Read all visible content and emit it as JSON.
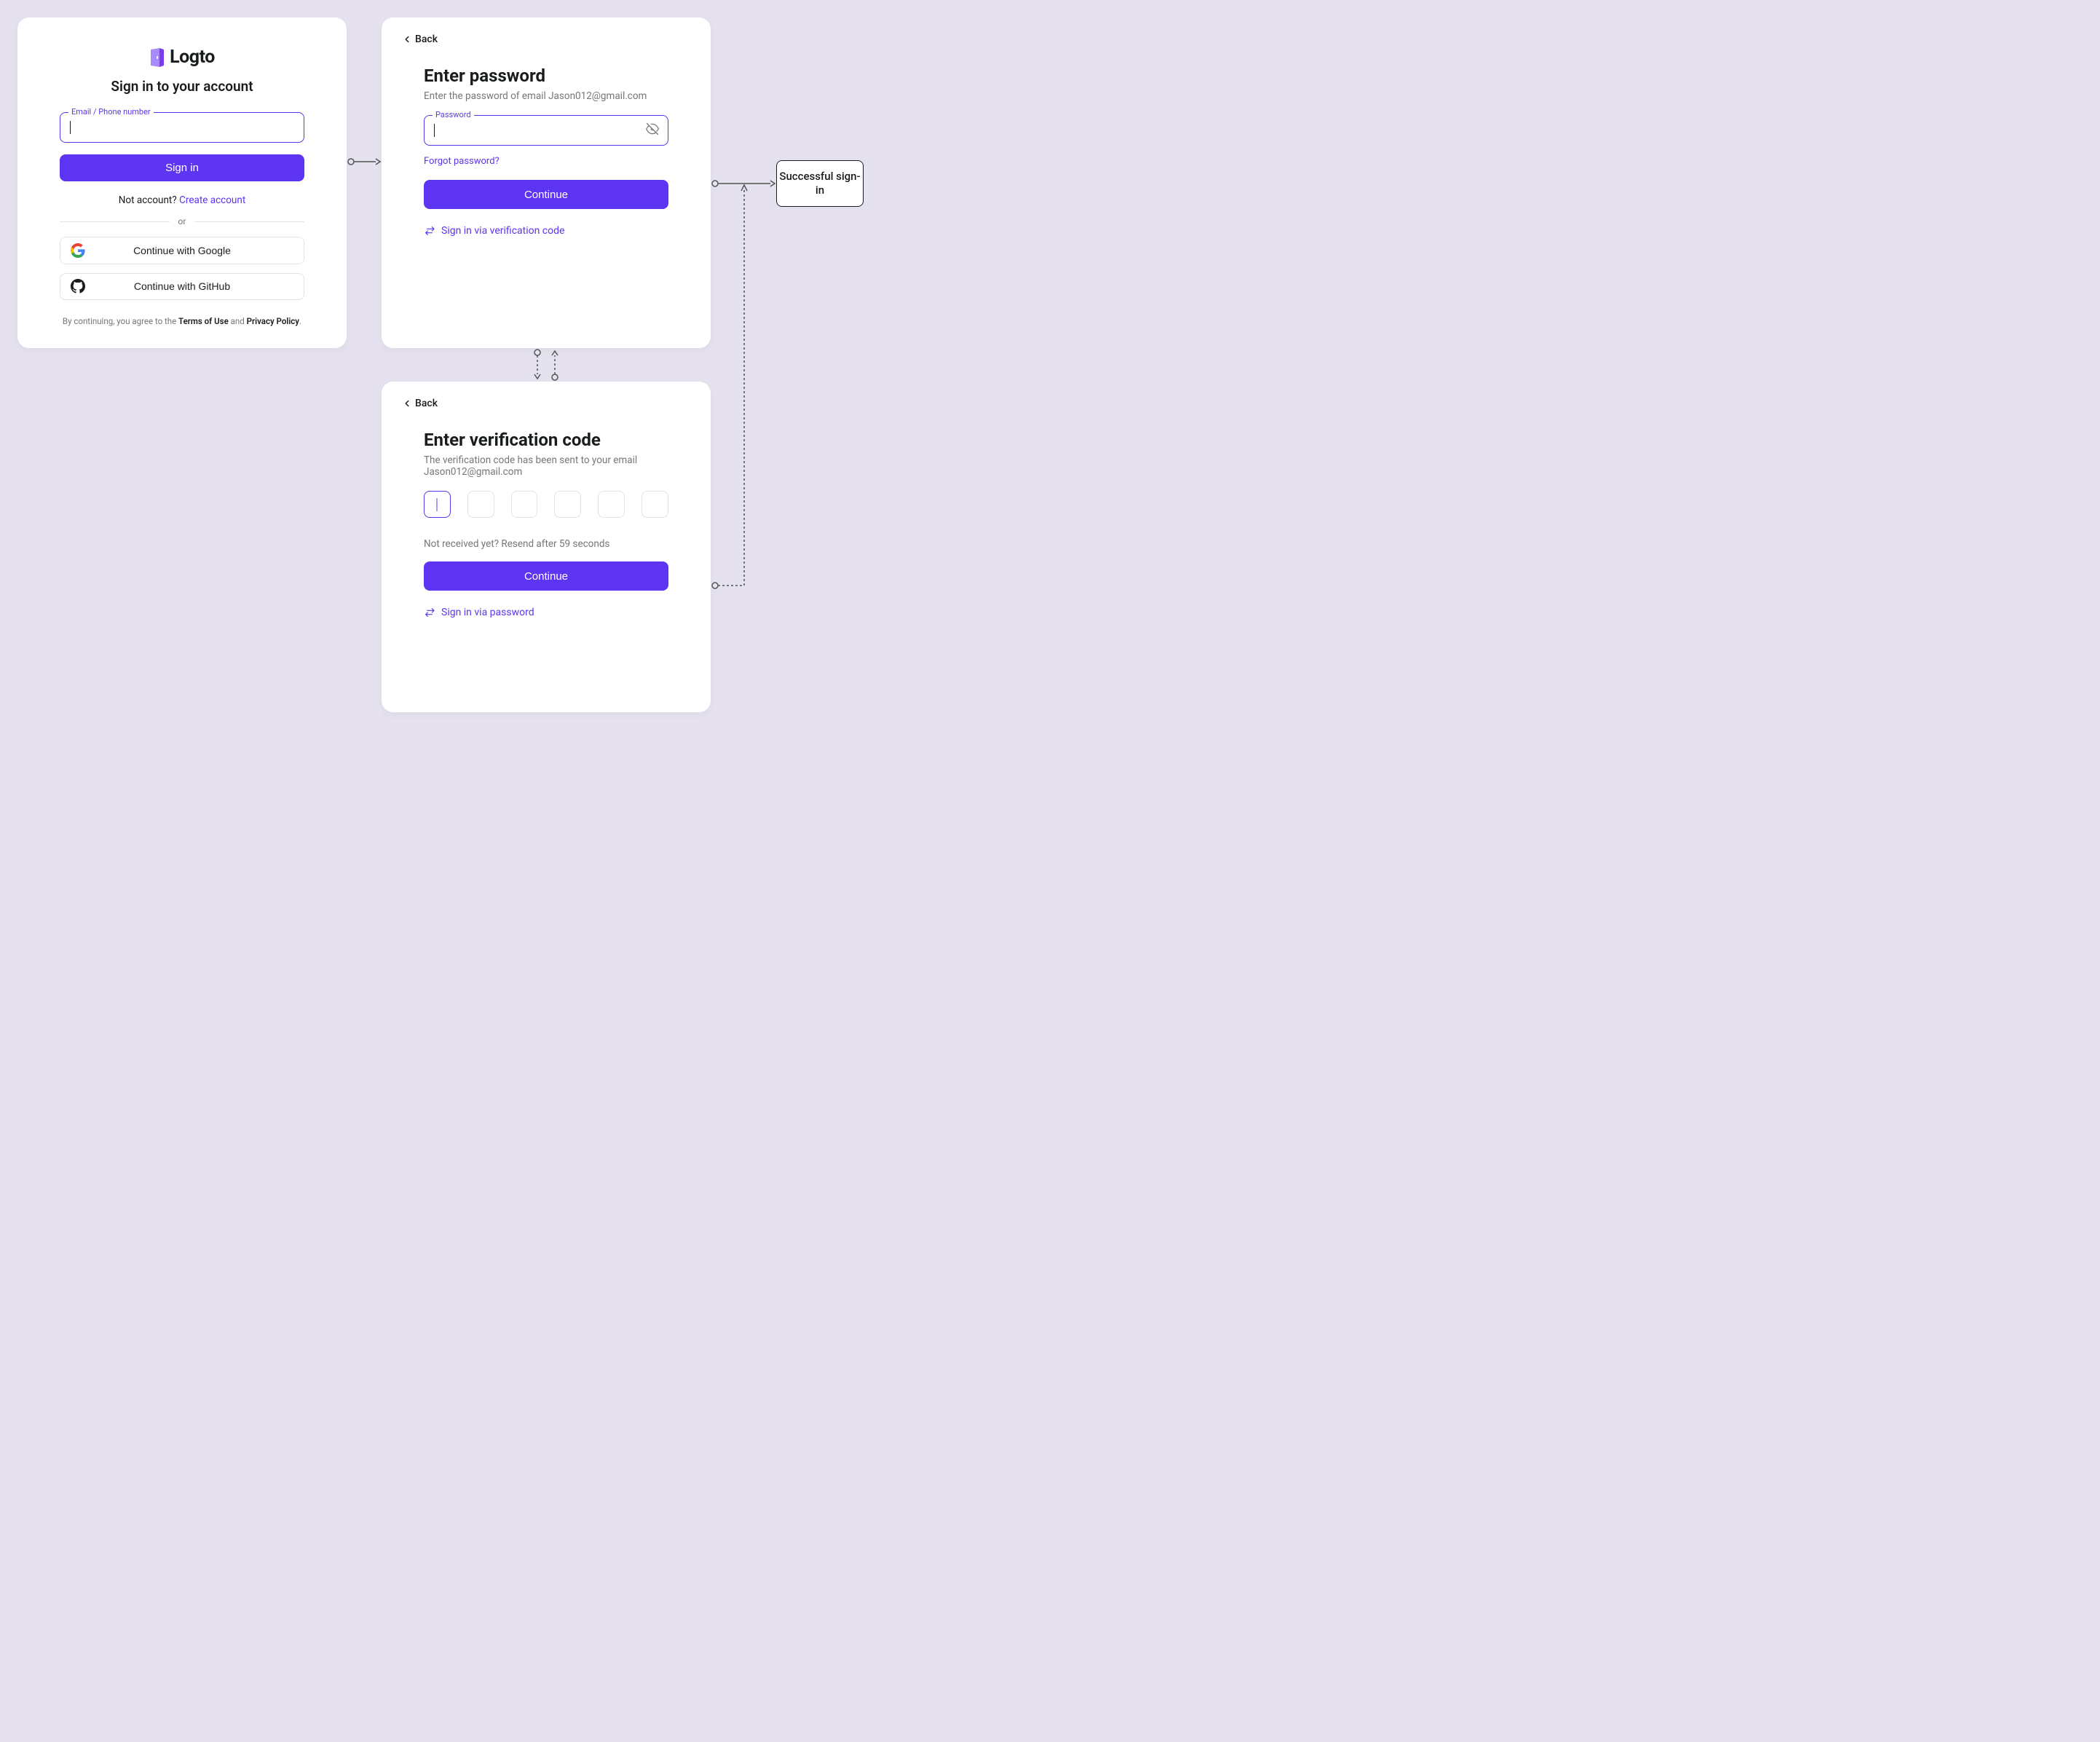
{
  "signin": {
    "brand": "Logto",
    "title": "Sign in to your account",
    "id_label": "Email / Phone number",
    "button": "Sign in",
    "no_account_prefix": "Not account? ",
    "create_account": "Create account",
    "divider": "or",
    "google": "Continue with Google",
    "github": "Continue with GitHub",
    "terms_prefix": "By continuing, you agree to the ",
    "terms_of_use": "Terms of Use",
    "terms_and": " and ",
    "privacy": "Privacy Policy",
    "terms_suffix": "."
  },
  "password": {
    "back": "Back",
    "title": "Enter password",
    "sub_prefix": "Enter the password of email ",
    "email": "Jason012@gmail.com",
    "label": "Password",
    "forgot": "Forgot password?",
    "continue": "Continue",
    "alt": "Sign in via verification code"
  },
  "code": {
    "back": "Back",
    "title": "Enter verification code",
    "sub_prefix": "The verification code has been sent to your email ",
    "email": "Jason012@gmail.com",
    "resend": "Not received yet? Resend after 59 seconds",
    "continue": "Continue",
    "alt": "Sign in via password"
  },
  "success": {
    "label": "Successful sign-in"
  }
}
